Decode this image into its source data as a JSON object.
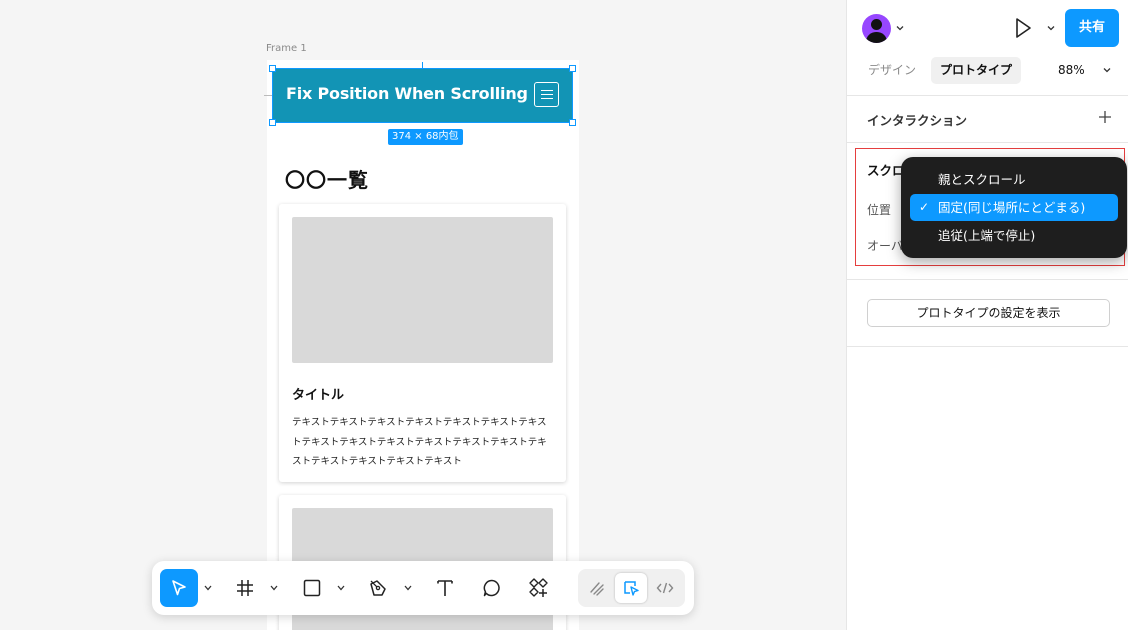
{
  "canvas": {
    "frame_label": "Frame 1",
    "header_title": "Fix Position When Scrolling",
    "size_badge": "374 × 68内包",
    "list_title": "〇〇一覧",
    "card": {
      "title": "タイトル",
      "text": "テキストテキストテキストテキストテキストテキストテキストテキストテキストテキストテキストテキストテキストテキストテキストテキストテキストテキスト"
    },
    "header_color": "#1294b5"
  },
  "toolbar": {
    "tools": [
      "move-tool",
      "frame-tool",
      "shape-tool",
      "pen-tool",
      "text-tool",
      "comment-tool",
      "actions-tool"
    ],
    "modes": [
      "draw-mode",
      "design-mode",
      "dev-mode"
    ],
    "accent": "#0d99ff"
  },
  "panel": {
    "share_label": "共有",
    "tabs": {
      "design": "デザイン",
      "prototype": "プロトタイプ"
    },
    "zoom": "88%",
    "interaction_title": "インタラクション",
    "scroll": {
      "title": "スクロ",
      "position_label": "位置",
      "overflow_label": "オーバ"
    },
    "proto_settings_button": "プロトタイプの設定を表示"
  },
  "dropdown": {
    "items": [
      {
        "label": "親とスクロール",
        "selected": false
      },
      {
        "label": "固定(同じ場所にとどまる)",
        "selected": true
      },
      {
        "label": "追従(上端で停止)",
        "selected": false
      }
    ],
    "check": "✓"
  }
}
